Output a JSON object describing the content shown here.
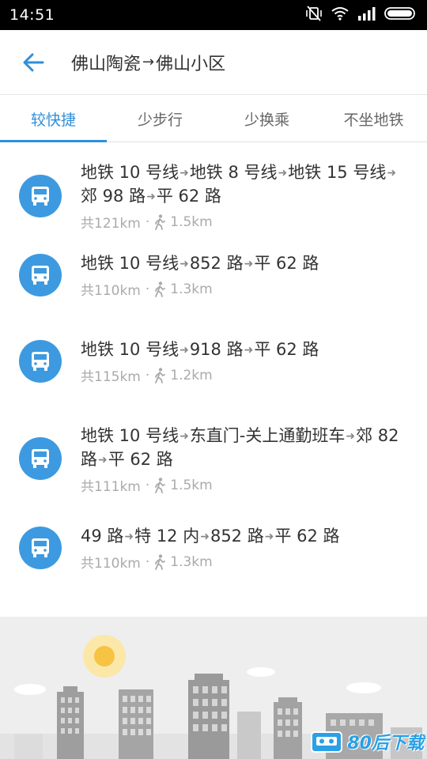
{
  "status_bar": {
    "time": "14:51"
  },
  "header": {
    "origin": "佛山陶瓷",
    "arrow": "→",
    "destination": "佛山小区"
  },
  "tabs": [
    {
      "label": "较快捷",
      "active": true
    },
    {
      "label": "少步行",
      "active": false
    },
    {
      "label": "少换乘",
      "active": false
    },
    {
      "label": "不坐地铁",
      "active": false
    }
  ],
  "routes": [
    {
      "segments": [
        "地铁 10 号线",
        "地铁 8 号线",
        "地铁 15 号线",
        "郊 98 路",
        "平 62 路"
      ],
      "total": "共121km",
      "walk": "1.5km"
    },
    {
      "segments": [
        "地铁 10 号线",
        "852 路",
        "平 62 路"
      ],
      "total": "共110km",
      "walk": "1.3km"
    },
    {
      "segments": [
        "地铁 10 号线",
        "918 路",
        "平 62 路"
      ],
      "total": "共115km",
      "walk": "1.2km"
    },
    {
      "segments": [
        "地铁 10 号线",
        "东直门-关上通勤班车",
        "郊 82 路",
        "平 62 路"
      ],
      "total": "共111km",
      "walk": "1.5km"
    },
    {
      "segments": [
        "49 路",
        "特 12 内",
        "852 路",
        "平 62 路"
      ],
      "total": "共110km",
      "walk": "1.3km"
    }
  ],
  "separator_glyph": "➜",
  "meta_dot": "·",
  "watermark": {
    "text": "80后下载"
  },
  "colors": {
    "accent": "#2f8fd8",
    "icon_bg": "#3d9ae0"
  }
}
